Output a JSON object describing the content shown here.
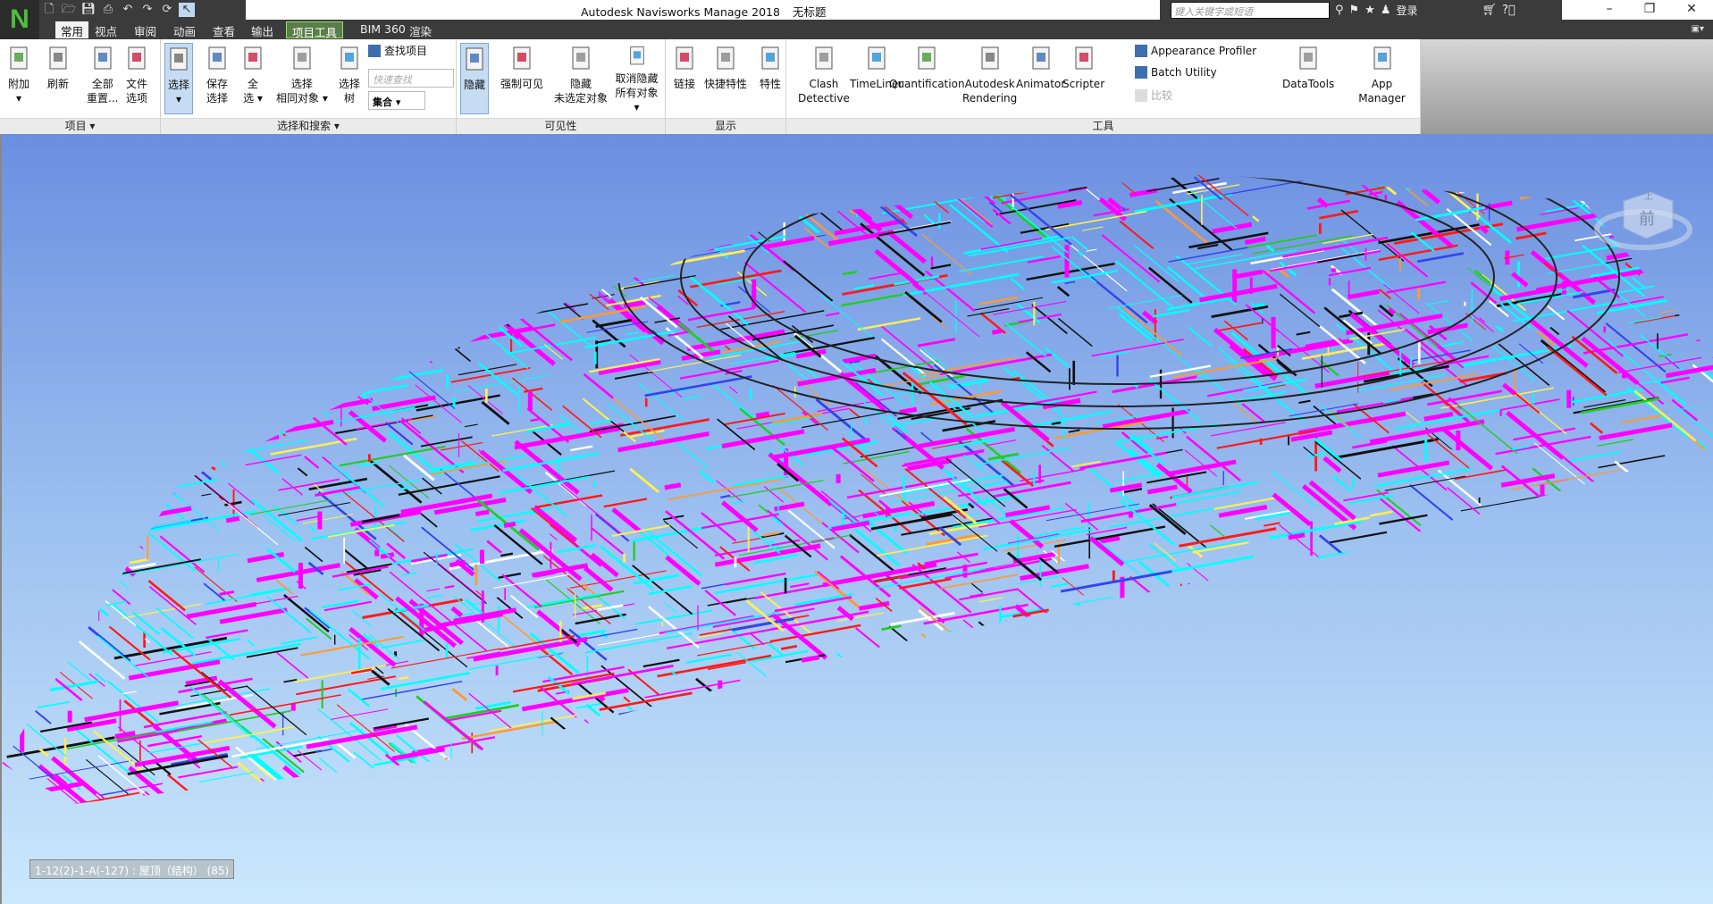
{
  "app": {
    "title": "Autodesk Navisworks Manage 2018",
    "document": "无标题",
    "logo": "N"
  },
  "quick_access": [
    "new-icon",
    "open-icon",
    "save-icon",
    "print-icon",
    "undo-icon",
    "redo-icon",
    "refresh-icon",
    "select-icon"
  ],
  "search": {
    "placeholder": "键入关键字或短语"
  },
  "user": {
    "login": "登录"
  },
  "tabs": [
    {
      "label": "常用",
      "state": "active"
    },
    {
      "label": "视点"
    },
    {
      "label": "审阅"
    },
    {
      "label": "动画"
    },
    {
      "label": "查看"
    },
    {
      "label": "输出"
    },
    {
      "label": "项目工具",
      "state": "highlight"
    },
    {
      "label": "BIM 360"
    },
    {
      "label": "渲染"
    }
  ],
  "panels": [
    {
      "label": "项目 ▾",
      "buttons": [
        {
          "lines": [
            "附加",
            "▾"
          ],
          "icon": "append-icon"
        },
        {
          "lines": [
            "刷新"
          ],
          "icon": "refresh-icon"
        },
        {
          "lines": [
            "全部",
            "重置..."
          ],
          "icon": "reset-all-icon"
        },
        {
          "lines": [
            "文件",
            "选项"
          ],
          "icon": "file-options-icon"
        }
      ]
    },
    {
      "label": "选择和搜索 ▾",
      "buttons": [
        {
          "lines": [
            "选择",
            "▾"
          ],
          "icon": "select-arrow-icon",
          "selected": true
        },
        {
          "lines": [
            "保存",
            "选择"
          ],
          "icon": "save-selection-icon"
        },
        {
          "lines": [
            "全",
            "选 ▾"
          ],
          "icon": "select-all-icon"
        },
        {
          "lines": [
            "选择",
            "相同对象 ▾"
          ],
          "icon": "select-same-icon"
        },
        {
          "lines": [
            "选择",
            "树"
          ],
          "icon": "selection-tree-icon"
        }
      ],
      "small": [
        {
          "label": "查找项目",
          "icon": "find-items-icon"
        }
      ],
      "quick_find_placeholder": "快速查找",
      "set_label": "集合"
    },
    {
      "label": "可见性",
      "buttons": [
        {
          "lines": [
            "隐藏"
          ],
          "icon": "hide-icon",
          "selected": true
        },
        {
          "lines": [
            "强制可见"
          ],
          "icon": "require-icon"
        },
        {
          "lines": [
            "隐藏",
            "未选定对象"
          ],
          "icon": "hide-unselected-icon"
        },
        {
          "lines": [
            "取消隐藏",
            "所有对象 ▾"
          ],
          "icon": "unhide-all-icon"
        }
      ]
    },
    {
      "label": "显示",
      "buttons": [
        {
          "lines": [
            "链接"
          ],
          "icon": "links-icon"
        },
        {
          "lines": [
            "快捷特性"
          ],
          "icon": "quick-properties-icon"
        },
        {
          "lines": [
            "特性"
          ],
          "icon": "properties-icon"
        }
      ]
    },
    {
      "label": "工具",
      "buttons": [
        {
          "lines": [
            "Clash",
            "Detective"
          ],
          "icon": "clash-detective-icon"
        },
        {
          "lines": [
            "TimeLiner"
          ],
          "icon": "timeliner-icon"
        },
        {
          "lines": [
            "Quantification"
          ],
          "icon": "quantification-icon"
        },
        {
          "lines": [
            "Autodesk",
            "Rendering"
          ],
          "icon": "rendering-icon"
        },
        {
          "lines": [
            "Animator"
          ],
          "icon": "animator-icon"
        },
        {
          "lines": [
            "Scripter"
          ],
          "icon": "scripter-icon"
        },
        {
          "lines": [
            "DataTools"
          ],
          "icon": "datatools-icon"
        },
        {
          "lines": [
            "App Manager"
          ],
          "icon": "app-manager-icon"
        }
      ],
      "small": [
        {
          "label": "Appearance Profiler",
          "icon": "appearance-profiler-icon"
        },
        {
          "label": "Batch Utility",
          "icon": "batch-utility-icon"
        },
        {
          "label": "比较",
          "icon": "compare-icon",
          "disabled": true
        }
      ]
    }
  ],
  "viewcube": {
    "face": "前",
    "label": "上"
  },
  "status": {
    "text": "1-12(2)-1-A(-127) : 屋顶（结构） (85)"
  },
  "colors": {
    "model": [
      "#ff00ff",
      "#00ffff",
      "#ff1a1a",
      "#111111",
      "#ffffff",
      "#ffee55",
      "#ff9933",
      "#3344ee",
      "#22cc22"
    ],
    "accent": "#c5dcf3"
  }
}
